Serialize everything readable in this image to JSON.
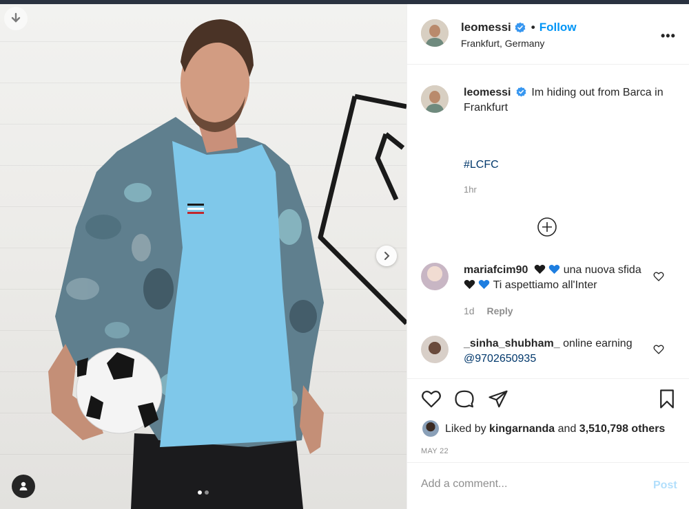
{
  "post": {
    "username": "leomessi",
    "verified": true,
    "follow_label": "Follow",
    "header_separator": "•",
    "location": "Frankfurt, Germany",
    "more_label": "•••",
    "caption_text": "Im hiding out from Barca in Frankfurt",
    "caption_hashtag": "#LCFC",
    "caption_time": "1hr",
    "photo_count": 2,
    "photo_active_index": 0
  },
  "comments": [
    {
      "username": "mariafcim90",
      "text_part1": "una nuova sfida",
      "text_part2": "Ti aspettiamo all'Inter",
      "age": "1d",
      "reply_label": "Reply"
    },
    {
      "username": "_sinha_shubham_",
      "text": "online earning",
      "mention": "@9702650935"
    }
  ],
  "likes": {
    "prefix": "Liked by",
    "liked_by": "kingarnanda",
    "connector": "and",
    "others": "3,510,798 others"
  },
  "date": "MAY 22",
  "composer": {
    "placeholder": "Add a comment...",
    "post_label": "Post"
  },
  "colors": {
    "link_blue": "#0095f6",
    "hashtag_blue": "#00376b",
    "muted_text": "#8e8e8e",
    "post_disabled": "#b2dffc",
    "divider": "#efefef"
  },
  "icons": [
    "download-icon",
    "chevron-right-icon",
    "user-tag-icon",
    "verified-badge-icon",
    "more-options-icon",
    "plus-circle-icon",
    "heart-icon",
    "comment-bubble-icon",
    "share-plane-icon",
    "bookmark-icon",
    "black-heart-emoji",
    "blue-heart-emoji"
  ]
}
